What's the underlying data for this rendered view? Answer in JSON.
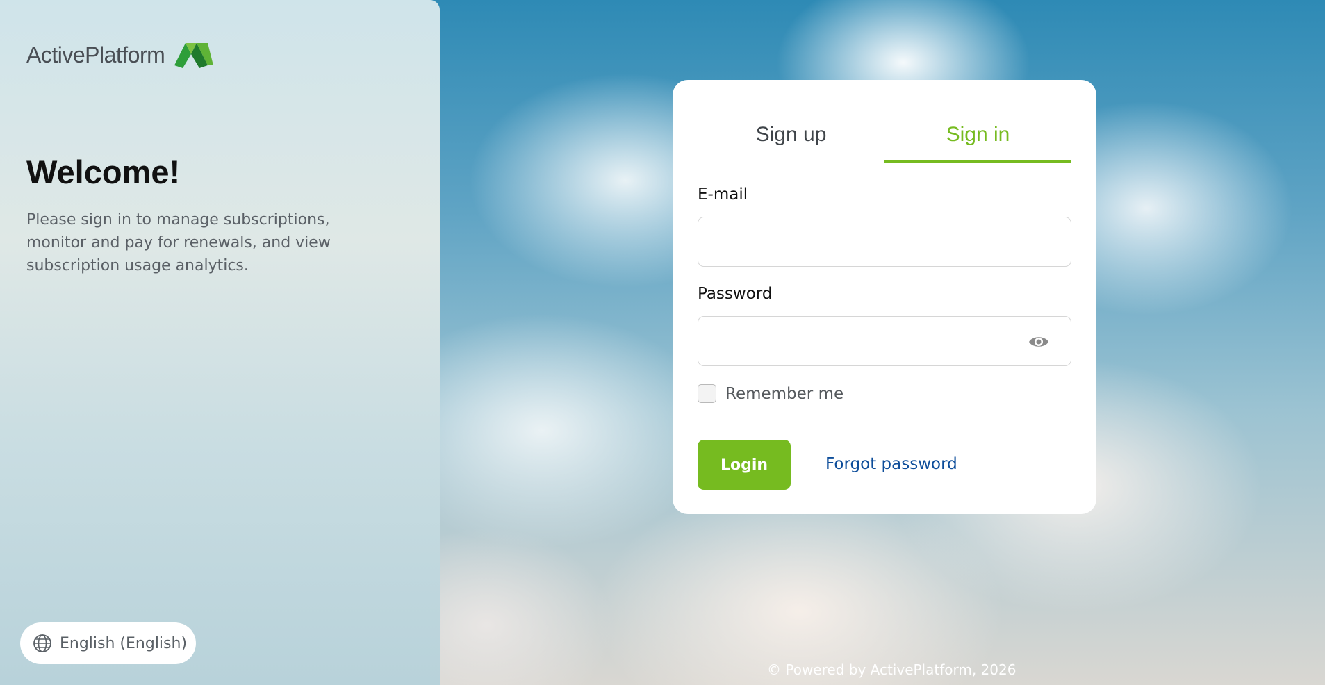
{
  "brand": {
    "name": "ActivePlatform",
    "logo_icon": "activeplatform-logo-icon",
    "accent": "#76bb20"
  },
  "left": {
    "title": "Welcome!",
    "intro": "Please sign in to manage subscriptions, monitor and pay for renewals, and view subscription usage analytics."
  },
  "language": {
    "label": "English (English)",
    "icon": "globe-icon"
  },
  "tabs": [
    {
      "label": "Sign up",
      "active": false
    },
    {
      "label": "Sign in",
      "active": true
    }
  ],
  "form": {
    "email_label": "E-mail",
    "email_value": "",
    "password_label": "Password",
    "password_value": "",
    "password_toggle_icon": "eye-icon",
    "remember_label": "Remember me",
    "remember_checked": false,
    "login_label": "Login",
    "forgot_label": "Forgot password"
  },
  "footer": {
    "text": "© Powered by ActivePlatform, 2026"
  },
  "colors": {
    "link": "#0d4d9a",
    "primary_button": "#76bb20"
  }
}
